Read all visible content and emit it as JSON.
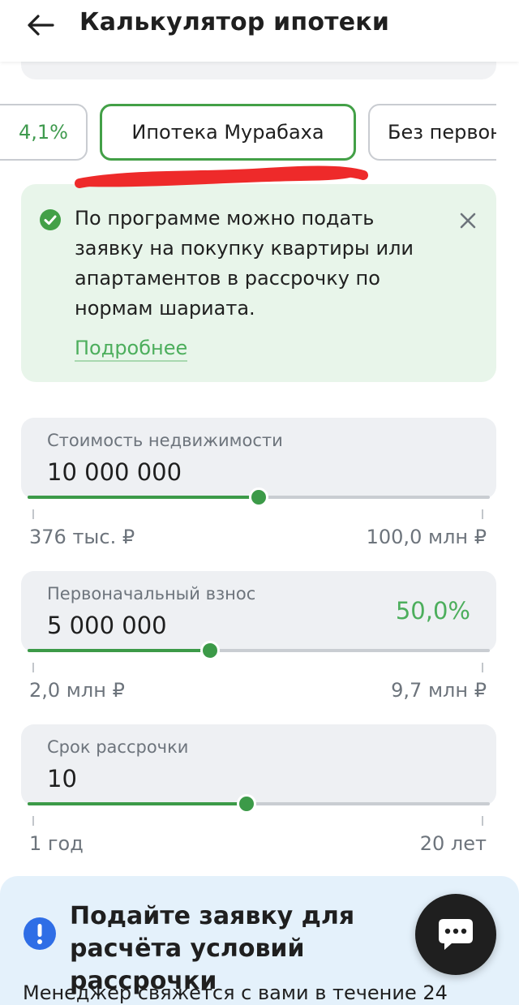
{
  "header": {
    "title": "Калькулятор ипотеки"
  },
  "chips": [
    {
      "label": "4,1%",
      "selected": false
    },
    {
      "label": "Ипотека Мурабаха",
      "selected": true
    },
    {
      "label": "Без первоначального",
      "selected": false
    }
  ],
  "info": {
    "text": "По программе можно подать заявку на покупку квартиры или апартаментов в рассрочку по нормам шариата.",
    "link": "Подробнее"
  },
  "fields": {
    "price": {
      "label": "Стоимость недвижимости",
      "value": "10 000 000",
      "slider_fraction": 0.5,
      "min_label": "376 тыс. ₽",
      "max_label": "100,0 млн ₽"
    },
    "down": {
      "label": "Первоначальный взнос",
      "value": "5 000 000",
      "percent": "50,0%",
      "slider_fraction": 0.395,
      "min_label": "2,0 млн ₽",
      "max_label": "9,7 млн ₽"
    },
    "term": {
      "label": "Срок рассрочки",
      "value": "10",
      "slider_fraction": 0.474,
      "min_label": "1 год",
      "max_label": "20 лет"
    }
  },
  "cta": {
    "title": "Подайте заявку для расчёта условий рассрочки",
    "subtitle": "Менеджер свяжется с вами в течение 24"
  },
  "colors": {
    "accent": "#43a047",
    "accent_text": "#4cae5c",
    "info_bg": "#e8f5ea",
    "cta_bg": "#e4f1fb",
    "field_bg": "#eef0f3",
    "annotation_red": "#ee2a2a"
  },
  "icons": {
    "back": "arrow-left-icon",
    "check": "check-circle-icon",
    "close": "close-icon",
    "info": "exclamation-circle-icon",
    "chat": "chat-bubble-icon"
  }
}
